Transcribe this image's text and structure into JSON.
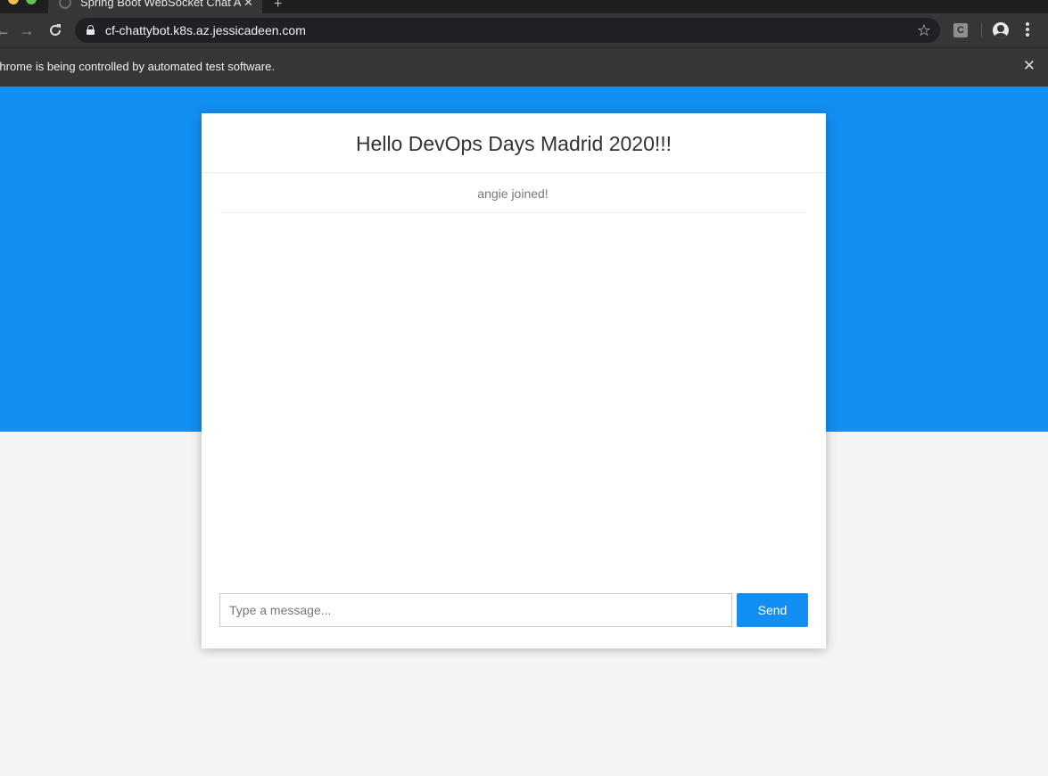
{
  "browser": {
    "tab": {
      "title": "Spring Boot WebSocket Chat Ap",
      "close_glyph": "✕"
    },
    "new_tab_glyph": "+",
    "address_bar": {
      "url": "cf-chattybot.k8s.az.jessicadeen.com"
    },
    "extension_label": "C",
    "infobar": {
      "text": "Chrome is being controlled by automated test software.",
      "close_glyph": "✕"
    },
    "icons": {
      "back": "arrow-left-icon",
      "forward": "arrow-right-icon",
      "reload": "reload-icon",
      "lock": "lock-icon",
      "bookmark": "star-icon",
      "profile": "profile-icon",
      "menu": "menu-dots-icon"
    }
  },
  "chat": {
    "title": "Hello DevOps Days Madrid 2020!!!",
    "messages": [
      {
        "type": "event",
        "text": "angie joined!"
      }
    ],
    "input": {
      "placeholder": "Type a message...",
      "value": ""
    },
    "send_label": "Send"
  },
  "colors": {
    "accent": "#128ff2",
    "page_background": "#f4f4f4",
    "browser_chrome": "#353638"
  }
}
